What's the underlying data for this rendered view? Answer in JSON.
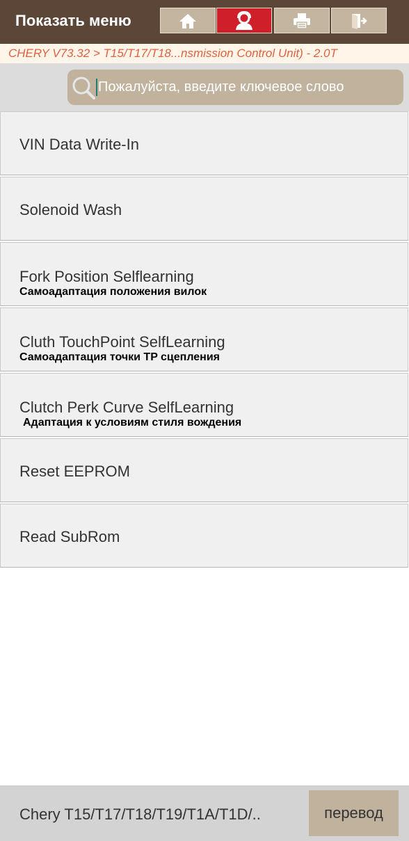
{
  "header": {
    "menu_label": "Показать меню",
    "buttons": [
      {
        "icon": "home-icon"
      },
      {
        "icon": "technician-icon",
        "active": true
      },
      {
        "icon": "printer-icon"
      },
      {
        "icon": "exit-icon"
      }
    ]
  },
  "breadcrumb": "CHERY V73.32 > T15/T17/T18...nsmission Control Unit) - 2.0T",
  "search": {
    "placeholder": "Пожалуйста, введите ключевое слово"
  },
  "items": [
    {
      "title": "VIN Data Write-In",
      "subtitle": ""
    },
    {
      "title": "Solenoid Wash",
      "subtitle": ""
    },
    {
      "title": "Fork Position Selflearning",
      "subtitle": "Самоадаптация положения вилок"
    },
    {
      "title": "Cluth TouchPoint SelfLearning",
      "subtitle": "Самоадаптация точки TP сцепления"
    },
    {
      "title": "Clutch Perk Curve SelfLearning",
      "subtitle": "Адаптация к условиям стиля вождения"
    },
    {
      "title": "Reset EEPROM",
      "subtitle": ""
    },
    {
      "title": "Read SubRom",
      "subtitle": ""
    }
  ],
  "footer": {
    "vehicle": "Chery T15/T17/T18/T19/T1A/T1D/..",
    "translate_label": "перевод"
  },
  "colors": {
    "topbar": "#5c4638",
    "active_button": "#cf1f2a",
    "button": "#c4b5a1",
    "breadcrumb_text": "#e2603f",
    "search_box": "#c1b29d"
  }
}
